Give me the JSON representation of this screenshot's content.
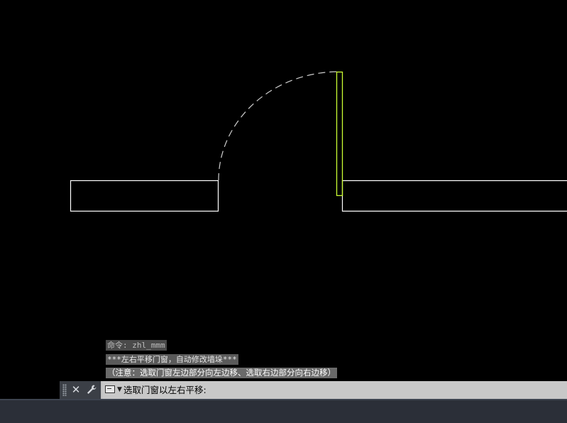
{
  "command_history": [
    "命令: zhl_mmm",
    "***左右平移门窗，自动修改墙垛***",
    "（注意：选取门窗左边部分向左边移、选取右边部分向右边移）"
  ],
  "command_line": {
    "prompt": "选取门窗以左右平移:"
  },
  "icons": {
    "grip": "grip-handle-icon",
    "close": "close-icon",
    "customize": "wrench-icon",
    "prompt": "command-prompt-icon",
    "recent": "chevron-down-icon"
  },
  "colors": {
    "background": "#000000",
    "wall_line": "#ffffff",
    "door_leaf_selected": "#ccff33",
    "swing_arc": "#cfcfcf",
    "command_bar": "#c8c8c8"
  }
}
